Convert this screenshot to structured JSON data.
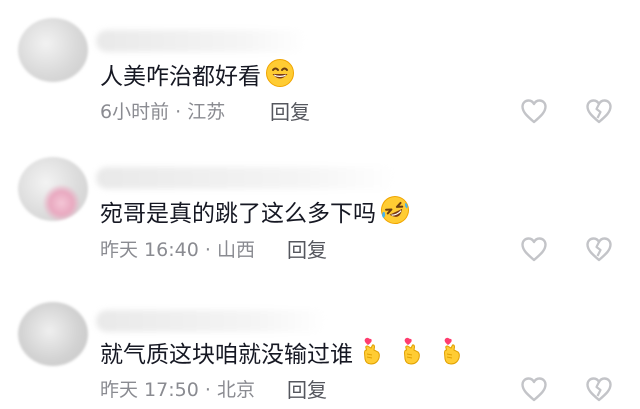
{
  "comments": [
    {
      "text": "人美咋治都好看",
      "emoji": [
        "grinning-face-emoji"
      ],
      "time": "6小时前",
      "location": "江苏",
      "reply_label": "回复"
    },
    {
      "text": "宛哥是真的跳了这么多下吗",
      "emoji": [
        "rolling-laughing-emoji"
      ],
      "time": "昨天 16:40",
      "location": "山西",
      "reply_label": "回复"
    },
    {
      "text": "就气质这块咱就没输过谁",
      "emoji": [
        "finger-heart-emoji",
        "finger-heart-emoji",
        "finger-heart-emoji"
      ],
      "time": "昨天 17:50",
      "location": "北京",
      "reply_label": "回复"
    }
  ],
  "meta_separator": "·",
  "icons": {
    "like": "heart-outline-icon",
    "dislike": "broken-heart-icon"
  },
  "colors": {
    "text": "#161823",
    "meta": "#8a8b91",
    "icon": "#c3c4c8",
    "emoji_yellow": "#ffcc33",
    "emoji_pink": "#ff3d6e"
  }
}
